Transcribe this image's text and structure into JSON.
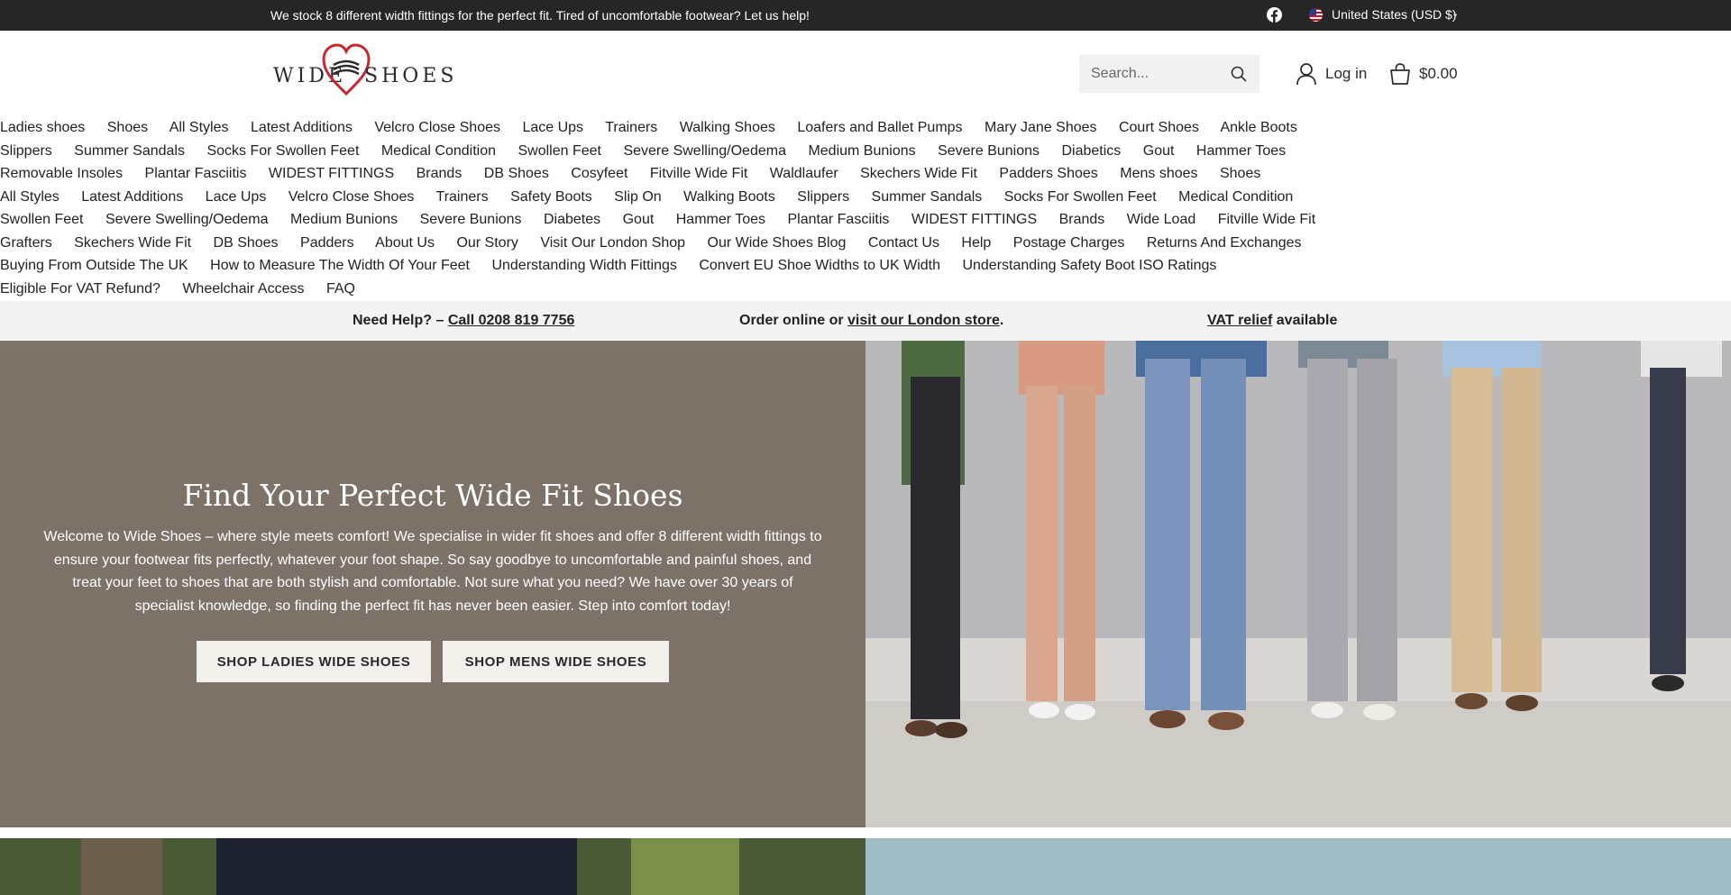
{
  "announcement": {
    "message": "We stock 8 different width fittings for the perfect fit. Tired of uncomfortable footwear? Let us help!",
    "currency": "United States (USD $)",
    "social_icon": "facebook-icon",
    "flag_icon": "us-flag-icon"
  },
  "header": {
    "logo_left": "WIDE",
    "logo_right": "SHOES",
    "search_placeholder": "Search...",
    "login_label": "Log in",
    "cart_total": "$0.00"
  },
  "menu": {
    "items": [
      "Ladies shoes",
      "Shoes",
      "All Styles",
      "Latest Additions",
      "Velcro Close Shoes",
      "Lace Ups",
      "Trainers",
      "Walking Shoes",
      "Loafers and Ballet Pumps",
      "Mary Jane Shoes",
      "Court Shoes",
      "Ankle Boots",
      "Slippers",
      "Summer Sandals",
      "Socks For Swollen Feet",
      "Medical Condition",
      "Swollen Feet",
      "Severe Swelling/Oedema",
      "Medium Bunions",
      "Severe Bunions",
      "Diabetics",
      "Gout",
      "Hammer Toes",
      "Removable Insoles",
      "Plantar Fasciitis",
      "WIDEST FITTINGS",
      "Brands",
      "DB Shoes",
      "Cosyfeet",
      "Fitville Wide Fit",
      "Waldlaufer",
      "Skechers Wide Fit",
      "Padders Shoes",
      "Mens shoes",
      "Shoes",
      "All Styles",
      "Latest Additions",
      "Lace Ups",
      "Velcro Close Shoes",
      "Trainers",
      "Safety Boots",
      "Slip On",
      "Walking Boots",
      "Slippers",
      "Summer Sandals",
      "Socks For Swollen Feet",
      "Medical Condition",
      "Swollen Feet",
      "Severe Swelling/Oedema",
      "Medium Bunions",
      "Severe Bunions",
      "Diabetes",
      "Gout",
      "Hammer Toes",
      "Plantar Fasciitis",
      "WIDEST FITTINGS",
      "Brands",
      "Wide Load",
      "Fitville Wide Fit",
      "Grafters",
      "Skechers Wide Fit",
      "DB Shoes",
      "Padders",
      "About Us",
      "Our Story",
      "Visit Our London Shop",
      "Our Wide Shoes Blog",
      "Contact Us",
      "Help",
      "Postage Charges",
      "Returns And Exchanges",
      "Buying From Outside The UK",
      "How to Measure The Width Of Your Feet",
      "Understanding Width Fittings",
      "Convert EU Shoe Widths to UK Width",
      "Understanding Safety Boot ISO Ratings",
      "Eligible For VAT Refund?",
      "Wheelchair Access",
      "FAQ"
    ]
  },
  "helpbar": {
    "need_help": "Need Help? –",
    "phone": "Call 0208 819 7756",
    "order_prefix": "Order online or",
    "store_link": "visit our London store",
    "order_suffix": ".",
    "vat_link": "VAT relief",
    "vat_suffix": "available"
  },
  "hero": {
    "title": "Find Your Perfect Wide Fit Shoes",
    "body": "Welcome to Wide Shoes – where style meets comfort! We specialise in wider fit shoes and offer 8 different width fittings to ensure your footwear fits perfectly, whatever your foot shape. So say goodbye to uncomfortable and painful shoes, and treat your feet to shoes that are both stylish and comfortable. Not sure what you need? We have over 30 years of specialist knowledge, so finding the perfect fit has never been easier. Step into comfort today!",
    "button_ladies": "SHOP LADIES WIDE SHOES",
    "button_mens": "SHOP MENS WIDE SHOES"
  },
  "colors": {
    "announcement_bg": "#262626",
    "hero_bg": "#7c7268",
    "button_bg": "#f3efea",
    "helpbar_bg": "#f3f3f3",
    "logo_heart": "#c8282f"
  }
}
